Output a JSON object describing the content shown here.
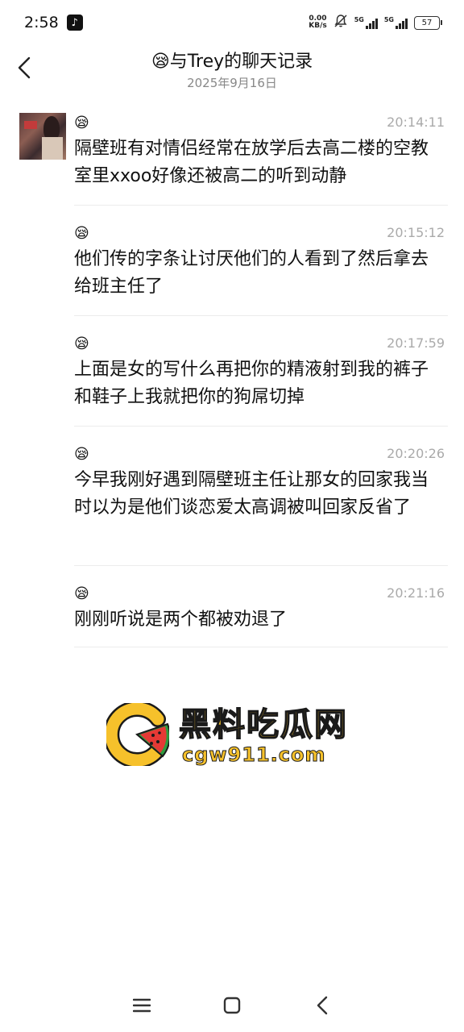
{
  "status_bar": {
    "time": "2:58",
    "app_badge": "♪",
    "net_speed_value": "0.00",
    "net_speed_unit": "KB/s",
    "sim1_label": "5G",
    "sim2_label": "5G",
    "battery": "57"
  },
  "header": {
    "title_emoji": "😪",
    "title": "与Trey的聊天记录",
    "date": "2025年9月16日"
  },
  "messages": [
    {
      "emoji": "😪",
      "time": "20:14:11",
      "text": "隔壁班有对情侣经常在放学后去高二楼的空教室里xxoo好像还被高二的听到动静"
    },
    {
      "emoji": "😪",
      "time": "20:15:12",
      "text": "他们传的字条让讨厌他们的人看到了然后拿去给班主任了"
    },
    {
      "emoji": "😪",
      "time": "20:17:59",
      "text": "上面是女的写什么再把你的精液射到我的裤子和鞋子上我就把你的狗屌切掉"
    },
    {
      "emoji": "😪",
      "time": "20:20:26",
      "text": "今早我刚好遇到隔壁班主任让那女的回家我当时以为是他们谈恋爱太高调被叫回家反省了"
    },
    {
      "emoji": "😪",
      "time": "20:21:16",
      "text": "刚刚听说是两个都被劝退了"
    }
  ],
  "watermark": {
    "title": "黑料吃瓜网",
    "url": "cgw911.com",
    "colors": {
      "primary": "#f6c12b",
      "outline": "#1a1a1a",
      "accent_red": "#e53935",
      "accent_green": "#2e9b3e"
    }
  },
  "nav_icons": [
    "menu-icon",
    "home-icon",
    "back-icon"
  ]
}
